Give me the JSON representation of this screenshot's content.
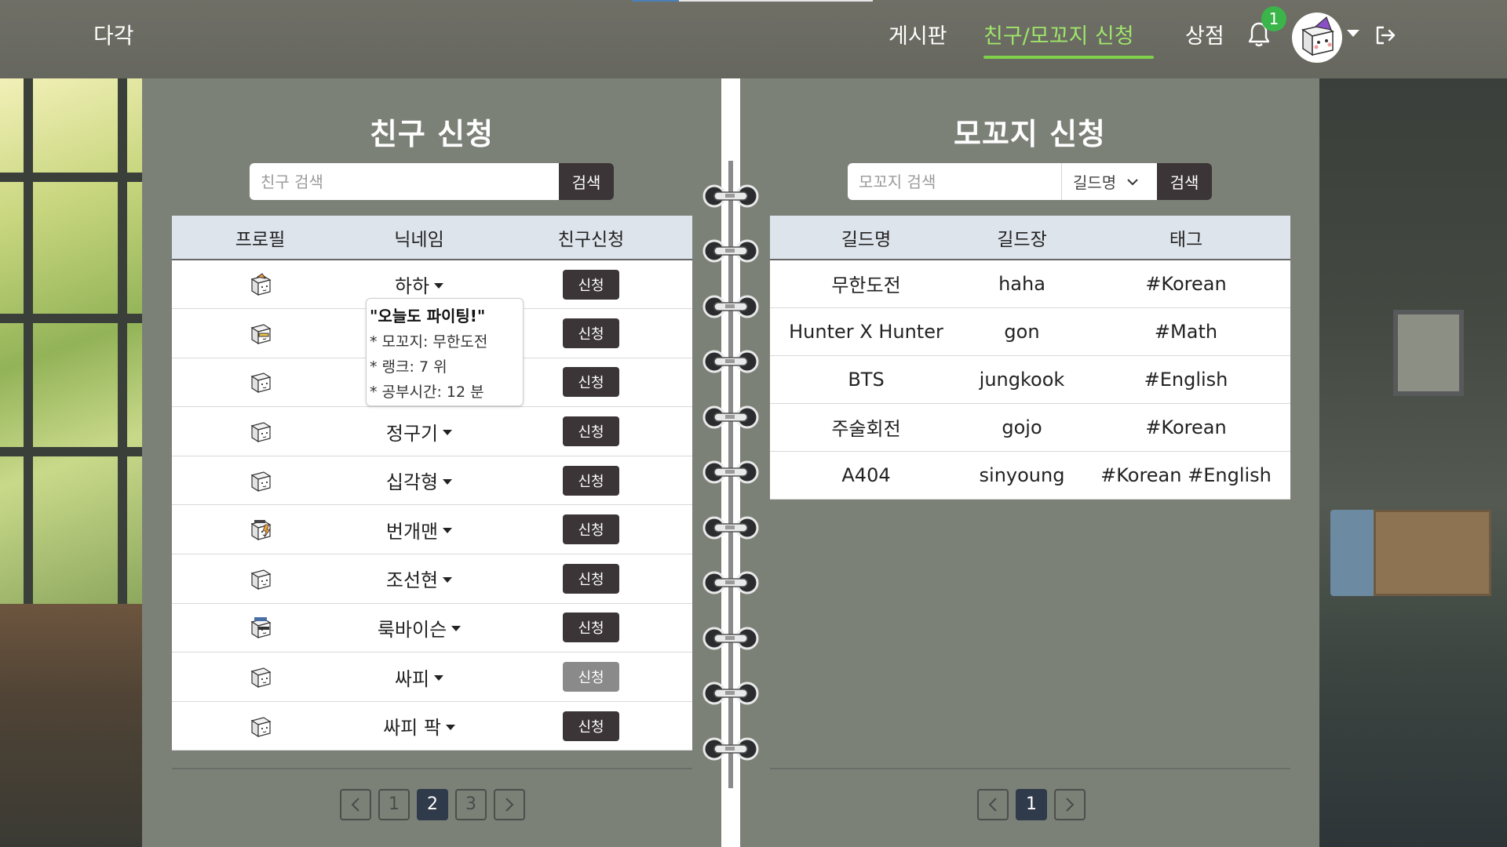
{
  "nav": {
    "logo": "다각",
    "links": [
      "게시판",
      "친구/모꼬지 신청",
      "상점"
    ],
    "notification_count": "1"
  },
  "friend_panel": {
    "title": "친구 신청",
    "search_placeholder": "친구 검색",
    "search_button": "검색",
    "headers": [
      "프로필",
      "닉네임",
      "친구신청"
    ],
    "rows": [
      {
        "nickname": "하하",
        "button": "신청",
        "icon": "cube-avatar-orange-hat-icon",
        "enabled": true
      },
      {
        "nickname": "",
        "button": "신청",
        "icon": "cube-avatar-glasses-icon",
        "enabled": true
      },
      {
        "nickname": "",
        "button": "신청",
        "icon": "cube-avatar-plain-icon",
        "enabled": true
      },
      {
        "nickname": "정구기",
        "button": "신청",
        "icon": "cube-avatar-plain-icon",
        "enabled": true
      },
      {
        "nickname": "십각형",
        "button": "신청",
        "icon": "cube-avatar-plain-icon",
        "enabled": true
      },
      {
        "nickname": "번개맨",
        "button": "신청",
        "icon": "cube-avatar-lightning-icon",
        "enabled": true
      },
      {
        "nickname": "조선현",
        "button": "신청",
        "icon": "cube-avatar-plain-icon",
        "enabled": true
      },
      {
        "nickname": "룩바이슨",
        "button": "신청",
        "icon": "cube-avatar-sunglasses-icon",
        "enabled": true
      },
      {
        "nickname": "싸피",
        "button": "신청",
        "icon": "cube-avatar-plain-icon",
        "enabled": false
      },
      {
        "nickname": "싸피 팍",
        "button": "신청",
        "icon": "cube-avatar-plain-icon",
        "enabled": true
      }
    ],
    "tooltip": {
      "quote": "\"오늘도 파이팅!\"",
      "guild": "* 모꼬지: 무한도전",
      "rank": "* 랭크: 7 위",
      "study_time": "* 공부시간: 12 분"
    },
    "pagination": {
      "pages": [
        "1",
        "2",
        "3"
      ],
      "current": "2"
    }
  },
  "guild_panel": {
    "title": "모꼬지 신청",
    "search_placeholder": "모꼬지 검색",
    "select_value": "길드명",
    "search_button": "검색",
    "headers": [
      "길드명",
      "길드장",
      "태그"
    ],
    "rows": [
      {
        "name": "무한도전",
        "leader": "haha",
        "tags": "#Korean"
      },
      {
        "name": "Hunter X Hunter",
        "leader": "gon",
        "tags": "#Math"
      },
      {
        "name": "BTS",
        "leader": "jungkook",
        "tags": "#English"
      },
      {
        "name": "주술회전",
        "leader": "gojo",
        "tags": "#Korean"
      },
      {
        "name": "A404",
        "leader": "sinyoung",
        "tags": "#Korean #English"
      }
    ],
    "pagination": {
      "pages": [
        "1"
      ],
      "current": "1"
    }
  },
  "colors": {
    "accent_active": "#9fe56a",
    "page_bg": "#7c8178",
    "button_dark": "#3b3537",
    "header_bg": "#dee4ec",
    "pager_active": "#2f3a4a"
  }
}
